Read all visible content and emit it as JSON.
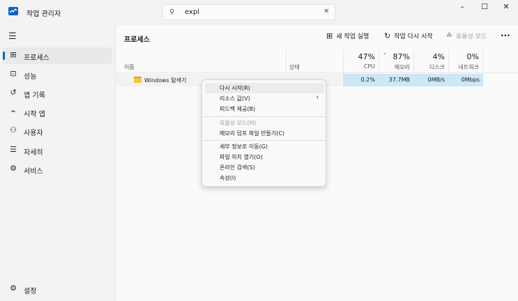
{
  "window": {
    "title": "작업 관리자",
    "buttons": {
      "minimize": "–",
      "maximize": "☐",
      "close": "✕"
    }
  },
  "search": {
    "value": "expl",
    "clear": "✕"
  },
  "sidebar": {
    "items": [
      {
        "label": "프로세스",
        "icon": "processes-icon",
        "glyph": "⊞",
        "selected": true
      },
      {
        "label": "성능",
        "icon": "performance-icon",
        "glyph": "⊡"
      },
      {
        "label": "앱 기록",
        "icon": "history-icon",
        "glyph": "↺"
      },
      {
        "label": "시작 앱",
        "icon": "startup-icon",
        "glyph": "⌁"
      },
      {
        "label": "사용자",
        "icon": "users-icon",
        "glyph": "⚇"
      },
      {
        "label": "자세히",
        "icon": "details-icon",
        "glyph": "☰"
      },
      {
        "label": "서비스",
        "icon": "services-icon",
        "glyph": "⚙"
      }
    ],
    "settings": {
      "label": "설정",
      "glyph": "⚙"
    }
  },
  "page": {
    "title": "프로세스",
    "toolbar": {
      "new_task": "새 작업 실행",
      "restart_task": "작업 다시 시작",
      "efficiency_mode": "효율성 모드",
      "more": "···"
    }
  },
  "table": {
    "columns": {
      "name": "이름",
      "status": "상태",
      "cpu": {
        "pct": "47%",
        "label": "CPU"
      },
      "memory": {
        "pct": "87%",
        "label": "메모리"
      },
      "disk": {
        "pct": "4%",
        "label": "디스크"
      },
      "network": {
        "pct": "0%",
        "label": "네트워크"
      }
    },
    "rows": [
      {
        "name": "Windows 탐색기",
        "status": "",
        "cpu": "0.2%",
        "memory": "37.7MB",
        "disk": "0MB/s",
        "network": "0Mbps"
      }
    ]
  },
  "context_menu": {
    "groups": [
      [
        {
          "label": "다시 시작(R)"
        },
        {
          "label": "리소스 값(V)",
          "submenu": "›"
        },
        {
          "label": "피드백 제공(B)"
        }
      ],
      [
        {
          "label": "효율성 모드(M)",
          "disabled": true
        },
        {
          "label": "메모리 덤프 파일 만들기(C)"
        }
      ],
      [
        {
          "label": "세부 정보로 이동(G)"
        },
        {
          "label": "파일 위치 열기(O)"
        },
        {
          "label": "온라인 검색(S)"
        },
        {
          "label": "속성(I)"
        }
      ]
    ]
  },
  "colors": {
    "accent": "#0067c0",
    "highlight": "#cce8f4"
  }
}
